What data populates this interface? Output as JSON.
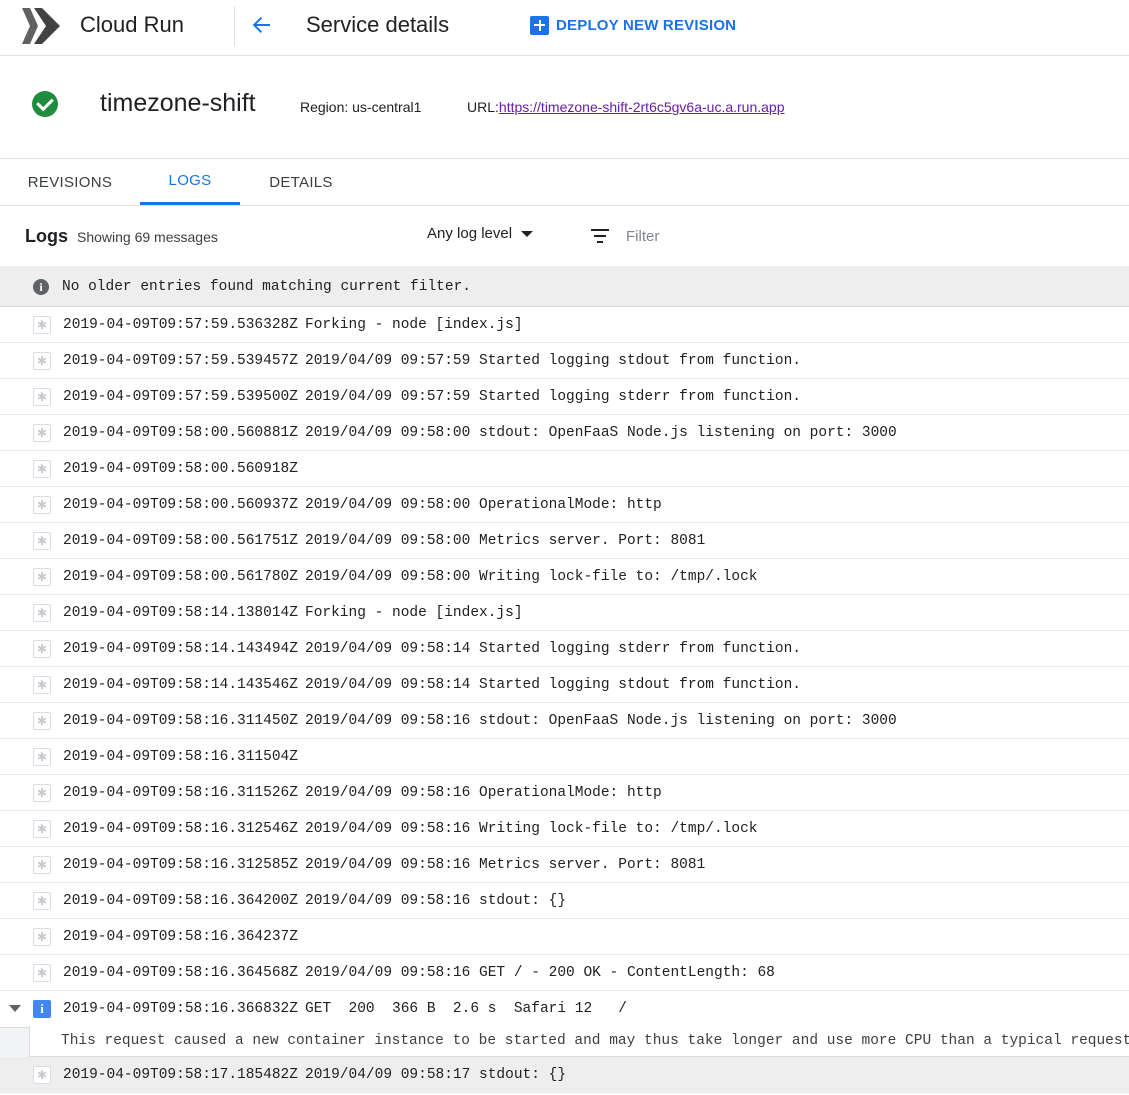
{
  "app": {
    "title": "Cloud Run",
    "logo_icon": "cloud-run-chevrons-icon",
    "brand_color": "#1a73e8"
  },
  "header": {
    "back_icon": "arrow-back-icon",
    "page_title": "Service details",
    "deploy_icon": "plus-box-icon",
    "deploy_label": "DEPLOY NEW REVISION"
  },
  "service": {
    "status_icon": "check-circle-icon",
    "status_color": "#1e8e3e",
    "name": "timezone-shift",
    "region": "Region: us-central1",
    "url_label": "URL:",
    "url": "https://timezone-shift-2rt6c5gv6a-uc.a.run.app"
  },
  "tabs": [
    {
      "label": "REVISIONS",
      "active": false
    },
    {
      "label": "LOGS",
      "active": true
    },
    {
      "label": "DETAILS",
      "active": false
    }
  ],
  "logs": {
    "title": "Logs",
    "count_text": "Showing 69 messages",
    "level_select": "Any log level",
    "filter_icon": "filter-list-icon",
    "filter_placeholder": "Filter",
    "notice_icon": "info-icon",
    "notice": "No older entries found matching current filter.",
    "entries": [
      {
        "severity": "default",
        "ts": "2019-04-09T09:57:59.536328Z",
        "msg": "Forking - node [index.js]"
      },
      {
        "severity": "default",
        "ts": "2019-04-09T09:57:59.539457Z",
        "msg": "2019/04/09 09:57:59 Started logging stdout from function."
      },
      {
        "severity": "default",
        "ts": "2019-04-09T09:57:59.539500Z",
        "msg": "2019/04/09 09:57:59 Started logging stderr from function."
      },
      {
        "severity": "default",
        "ts": "2019-04-09T09:58:00.560881Z",
        "msg": "2019/04/09 09:58:00 stdout: OpenFaaS Node.js listening on port: 3000"
      },
      {
        "severity": "default",
        "ts": "2019-04-09T09:58:00.560918Z",
        "msg": ""
      },
      {
        "severity": "default",
        "ts": "2019-04-09T09:58:00.560937Z",
        "msg": "2019/04/09 09:58:00 OperationalMode: http"
      },
      {
        "severity": "default",
        "ts": "2019-04-09T09:58:00.561751Z",
        "msg": "2019/04/09 09:58:00 Metrics server. Port: 8081"
      },
      {
        "severity": "default",
        "ts": "2019-04-09T09:58:00.561780Z",
        "msg": "2019/04/09 09:58:00 Writing lock-file to: /tmp/.lock"
      },
      {
        "severity": "default",
        "ts": "2019-04-09T09:58:14.138014Z",
        "msg": "Forking - node [index.js]"
      },
      {
        "severity": "default",
        "ts": "2019-04-09T09:58:14.143494Z",
        "msg": "2019/04/09 09:58:14 Started logging stderr from function."
      },
      {
        "severity": "default",
        "ts": "2019-04-09T09:58:14.143546Z",
        "msg": "2019/04/09 09:58:14 Started logging stdout from function."
      },
      {
        "severity": "default",
        "ts": "2019-04-09T09:58:16.311450Z",
        "msg": "2019/04/09 09:58:16 stdout: OpenFaaS Node.js listening on port: 3000"
      },
      {
        "severity": "default",
        "ts": "2019-04-09T09:58:16.311504Z",
        "msg": ""
      },
      {
        "severity": "default",
        "ts": "2019-04-09T09:58:16.311526Z",
        "msg": "2019/04/09 09:58:16 OperationalMode: http"
      },
      {
        "severity": "default",
        "ts": "2019-04-09T09:58:16.312546Z",
        "msg": "2019/04/09 09:58:16 Writing lock-file to: /tmp/.lock"
      },
      {
        "severity": "default",
        "ts": "2019-04-09T09:58:16.312585Z",
        "msg": "2019/04/09 09:58:16 Metrics server. Port: 8081"
      },
      {
        "severity": "default",
        "ts": "2019-04-09T09:58:16.364200Z",
        "msg": "2019/04/09 09:58:16 stdout: {}"
      },
      {
        "severity": "default",
        "ts": "2019-04-09T09:58:16.364237Z",
        "msg": ""
      },
      {
        "severity": "default",
        "ts": "2019-04-09T09:58:16.364568Z",
        "msg": "2019/04/09 09:58:16 GET / - 200 OK - ContentLength: 68"
      },
      {
        "severity": "info",
        "ts": "2019-04-09T09:58:16.366832Z",
        "msg": "GET  200  366 B  2.6 s  Safari 12   /",
        "expanded": true,
        "detail": "This request caused a new container instance to be started and may thus take longer and use more CPU than a typical request."
      },
      {
        "severity": "default",
        "ts": "2019-04-09T09:58:17.185482Z",
        "msg": "2019/04/09 09:58:17 stdout: {}",
        "selected": true
      }
    ]
  }
}
